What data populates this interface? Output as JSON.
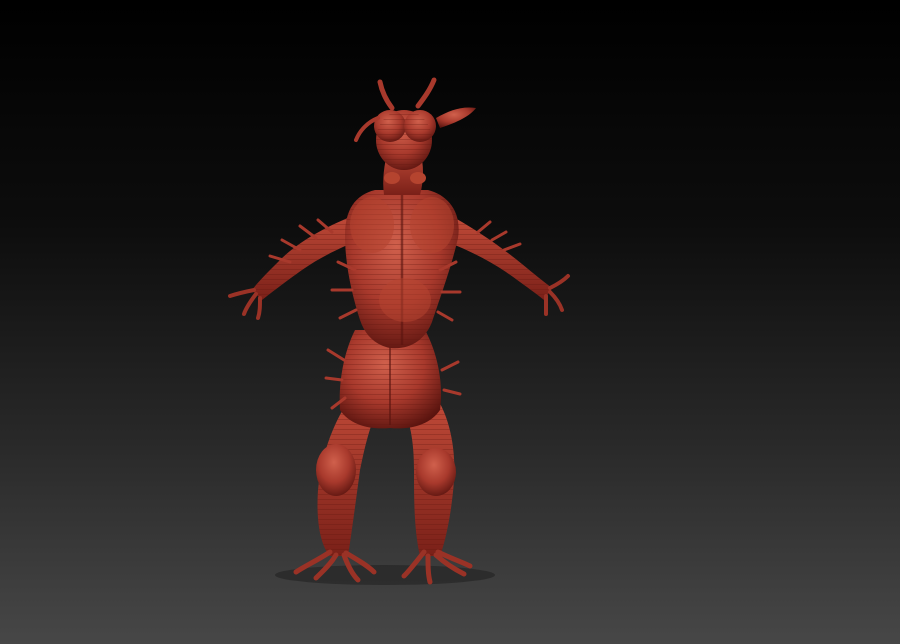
{
  "viewport": {
    "background_top": "#000000",
    "background_bottom": "#474747"
  },
  "model": {
    "subject": "creature-sculpt",
    "material_color": "#a8392c",
    "highlight_color": "#d0604c",
    "shadow_color": "#5a140f"
  }
}
